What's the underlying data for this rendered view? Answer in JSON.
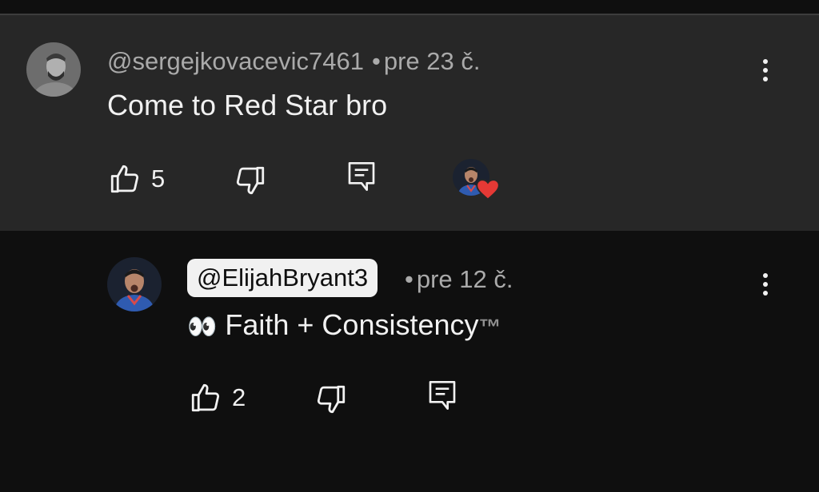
{
  "colors": {
    "background": "#0f0f0f",
    "highlight": "#272727",
    "text": "#f1f1f1",
    "secondary": "#aaaaaa",
    "heart": "#e53935"
  },
  "comment": {
    "author": "@sergejkovacevic7461",
    "separator": "•",
    "time": "pre 23 č.",
    "text": "Come to Red Star bro",
    "likes": "5",
    "icons": {
      "like": "thumbs-up-icon",
      "dislike": "thumbs-down-icon",
      "reply": "reply-icon",
      "menu": "more-vert-icon",
      "creator_heart": "creator-heart-icon"
    }
  },
  "reply": {
    "author": "@ElijahBryant3",
    "separator": "•",
    "time": "pre 12 č.",
    "emoji": "👀",
    "text": "Faith + Consistency",
    "tm": "™",
    "likes": "2"
  }
}
